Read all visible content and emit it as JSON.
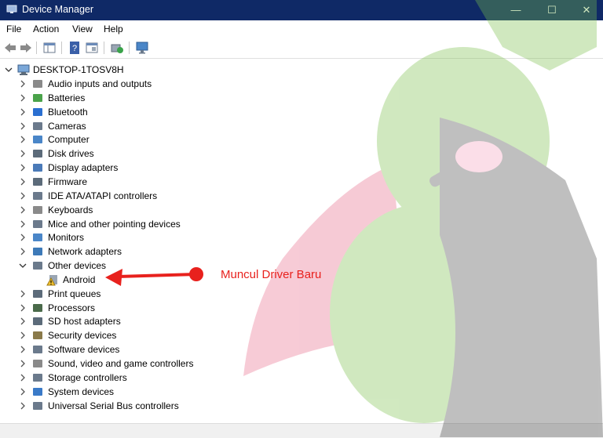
{
  "window": {
    "title": "Device Manager",
    "minimize_icon": "minimize-icon",
    "maximize_icon": "maximize-icon",
    "close_icon": "close-icon"
  },
  "menu": {
    "file": "File",
    "action": "Action",
    "view": "View",
    "help": "Help"
  },
  "toolbar": {
    "buttons": [
      "back-arrow-icon",
      "forward-arrow-icon",
      "show-hide-tree-icon",
      "help-icon",
      "properties-icon",
      "update-driver-icon",
      "scan-hardware-icon"
    ]
  },
  "tree": {
    "root": "DESKTOP-1TOSV8H",
    "categories": [
      "Audio inputs and outputs",
      "Batteries",
      "Bluetooth",
      "Cameras",
      "Computer",
      "Disk drives",
      "Display adapters",
      "Firmware",
      "IDE ATA/ATAPI controllers",
      "Keyboards",
      "Mice and other pointing devices",
      "Monitors",
      "Network adapters",
      "Other devices",
      "Print queues",
      "Processors",
      "SD host adapters",
      "Security devices",
      "Software devices",
      "Sound, video and game controllers",
      "Storage controllers",
      "System devices",
      "Universal Serial Bus controllers"
    ],
    "other_devices_child": "Android"
  },
  "annotation": {
    "text": "Muncul Driver Baru",
    "color": "#e8211d"
  },
  "colors": {
    "titlebar": "#0f2966",
    "accent_red": "#e8211d"
  }
}
